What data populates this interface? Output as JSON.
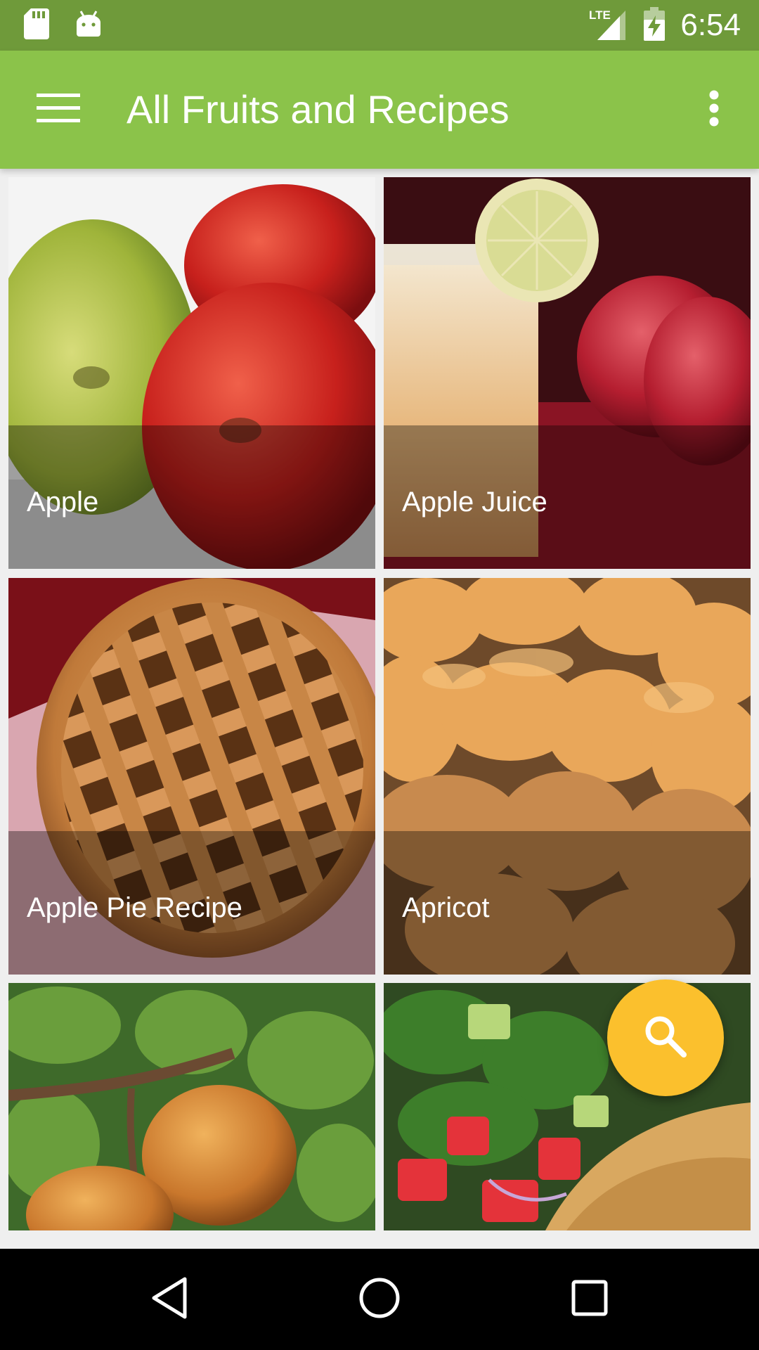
{
  "status_bar": {
    "time": "6:54",
    "network_label": "LTE",
    "icons": [
      "sd-card-icon",
      "android-icon",
      "lte-signal-icon",
      "battery-charging-icon"
    ]
  },
  "app_bar": {
    "title": "All Fruits and Recipes",
    "menu_icon": "hamburger-menu-icon",
    "overflow_icon": "overflow-menu-icon"
  },
  "items": [
    {
      "label": "Apple"
    },
    {
      "label": "Apple Juice"
    },
    {
      "label": "Apple Pie Recipe"
    },
    {
      "label": "Apricot"
    },
    {
      "label": ""
    },
    {
      "label": ""
    }
  ],
  "fab": {
    "icon": "search-icon"
  },
  "nav_bar": {
    "icons": [
      "back-icon",
      "home-icon",
      "recents-icon"
    ]
  },
  "colors": {
    "status_bar": "#6f9a3a",
    "app_bar": "#8bc34a",
    "fab": "#fbc02d",
    "nav_bar": "#000000"
  }
}
